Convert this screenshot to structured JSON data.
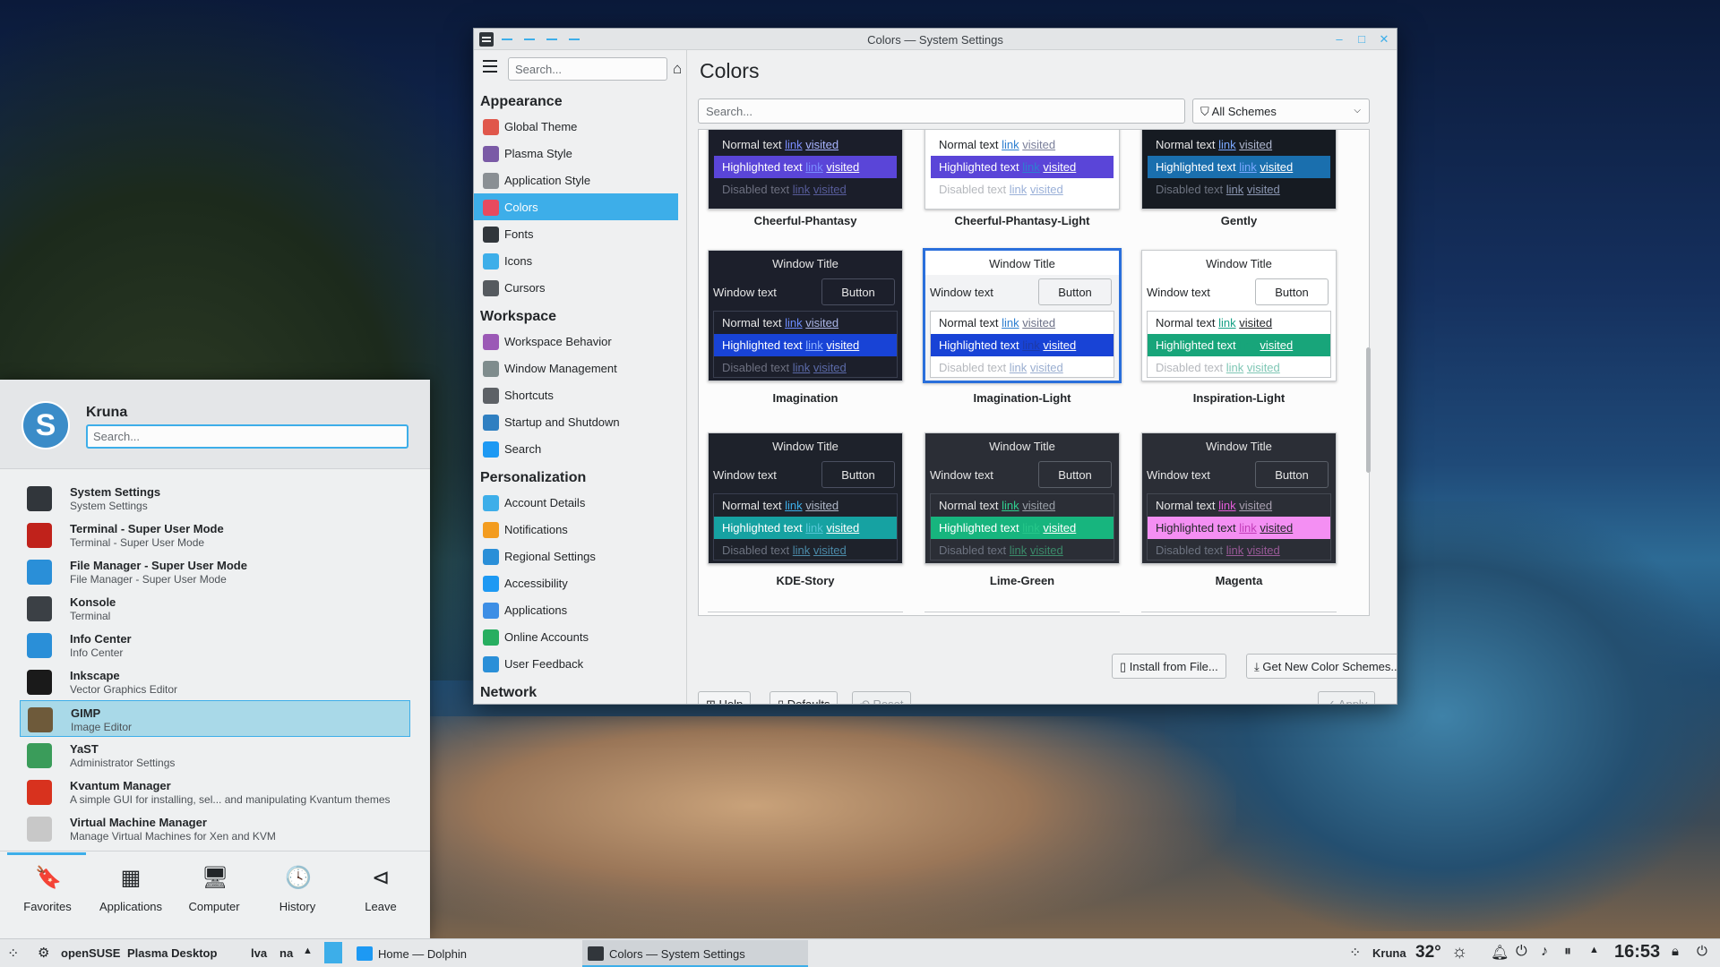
{
  "window": {
    "title": "Colors — System Settings",
    "buttons": {
      "minimize": "–",
      "maximize": "□",
      "close": "✕"
    }
  },
  "sidebar": {
    "search_placeholder": "Search...",
    "sections": [
      {
        "title": "Appearance",
        "items": [
          {
            "label": "Global Theme",
            "icon": "global-theme-icon",
            "color": "#e0574b"
          },
          {
            "label": "Plasma Style",
            "icon": "plasma-style-icon",
            "color": "#7a5aa6"
          },
          {
            "label": "Application Style",
            "icon": "application-style-icon",
            "color": "#8a8f94"
          },
          {
            "label": "Colors",
            "icon": "colors-icon",
            "color": "#e84a5f",
            "active": true
          },
          {
            "label": "Fonts",
            "icon": "fonts-icon",
            "color": "#31363b"
          },
          {
            "label": "Icons",
            "icon": "icons-icon",
            "color": "#3daee9"
          },
          {
            "label": "Cursors",
            "icon": "cursors-icon",
            "color": "#555a5f"
          }
        ]
      },
      {
        "title": "Workspace",
        "items": [
          {
            "label": "Workspace Behavior",
            "icon": "workspace-behavior-icon",
            "color": "#9b59b6"
          },
          {
            "label": "Window Management",
            "icon": "window-management-icon",
            "color": "#7f8c8d"
          },
          {
            "label": "Shortcuts",
            "icon": "shortcuts-icon",
            "color": "#5d6166"
          },
          {
            "label": "Startup and Shutdown",
            "icon": "startup-shutdown-icon",
            "color": "#2f7fc1"
          },
          {
            "label": "Search",
            "icon": "search-icon",
            "color": "#1d99f3"
          }
        ]
      },
      {
        "title": "Personalization",
        "items": [
          {
            "label": "Account Details",
            "icon": "account-details-icon",
            "color": "#3daee9"
          },
          {
            "label": "Notifications",
            "icon": "notifications-icon",
            "color": "#f39c1f"
          },
          {
            "label": "Regional Settings",
            "icon": "regional-settings-icon",
            "color": "#2a8fd8"
          },
          {
            "label": "Accessibility",
            "icon": "accessibility-icon",
            "color": "#1d99f3"
          },
          {
            "label": "Applications",
            "icon": "applications-icon",
            "color": "#3c8ee5"
          },
          {
            "label": "Online Accounts",
            "icon": "online-accounts-icon",
            "color": "#27ae60"
          },
          {
            "label": "User Feedback",
            "icon": "user-feedback-icon",
            "color": "#2a8fd8"
          }
        ]
      },
      {
        "title": "Network",
        "items": []
      }
    ]
  },
  "main": {
    "title": "Colors",
    "search_placeholder": "Search...",
    "filter_label": "All Schemes",
    "preview_labels": {
      "window_title": "Window Title",
      "window_text": "Window text",
      "button": "Button",
      "normal": "Normal text",
      "highlighted": "Highlighted text",
      "disabled": "Disabled text",
      "link": "link",
      "visited": "visited"
    },
    "schemes_top": [
      {
        "name": "Cheerful-Phantasy",
        "view": "#1b1e2a",
        "view_fg": "#e6e6e6",
        "hl": "#5a45d8",
        "hl_fg": "#ffffff",
        "link": "#7a8cff",
        "visited": "#a8b4ff",
        "dis": "#6d7080",
        "dis_link": "#575c9a"
      },
      {
        "name": "Cheerful-Phantasy-Light",
        "view": "#ffffff",
        "view_fg": "#232629",
        "hl": "#5a45d8",
        "hl_fg": "#ffffff",
        "link": "#2e7fd0",
        "visited": "#7a7f9a",
        "dis": "#b5b8bd",
        "dis_link": "#9ab0d8"
      },
      {
        "name": "Gently",
        "view": "#161b22",
        "view_fg": "#e6e6e6",
        "hl": "#1a6fae",
        "hl_fg": "#ffffff",
        "link": "#7aa8ff",
        "visited": "#b0b8d0",
        "dis": "#6d7380",
        "dis_link": "#8a95b0"
      }
    ],
    "schemes": [
      {
        "name": "Imagination",
        "header": "#1c1f2b",
        "header_fg": "#e6e6e6",
        "win": "#1c1f2b",
        "win_fg": "#e6e6e6",
        "btn": "#1c1f2b",
        "btn_border": "#4a4f60",
        "btn_fg": "#e6e6e6",
        "view": "#1c1f2b",
        "view_fg": "#e6e6e6",
        "view_border": "#3a3f50",
        "hl": "#1843d6",
        "hl_fg": "#ffffff",
        "link": "#6c8cff",
        "visited": "#aab5e6",
        "hl_link": "#8fb0ff",
        "dis": "#6d7080",
        "dis_link": "#5b6aa8",
        "selected": false
      },
      {
        "name": "Imagination-Light",
        "header": "#ffffff",
        "header_fg": "#232629",
        "win": "#f2f3f5",
        "win_fg": "#232629",
        "btn": "#f2f3f5",
        "btn_border": "#b7bbbe",
        "btn_fg": "#232629",
        "view": "#ffffff",
        "view_fg": "#232629",
        "view_border": "#c4c7ca",
        "hl": "#1843d6",
        "hl_fg": "#ffffff",
        "link": "#2e7fd0",
        "visited": "#6d7288",
        "hl_link": "#1d3aa8",
        "dis": "#b5b8bd",
        "dis_link": "#9aaed0",
        "selected": true
      },
      {
        "name": "Inspiration-Light",
        "header": "#ffffff",
        "header_fg": "#232629",
        "win": "#ffffff",
        "win_fg": "#232629",
        "btn": "#ffffff",
        "btn_border": "#b7bbbe",
        "btn_fg": "#232629",
        "view": "#ffffff",
        "view_fg": "#232629",
        "view_border": "#c4c7ca",
        "hl": "#18a57a",
        "hl_fg": "#ffffff",
        "link": "#16a085",
        "visited": "#232629",
        "hl_link": "#18a57a",
        "dis": "#b5b8bd",
        "dis_link": "#7fc7b5",
        "selected": false
      },
      {
        "name": "KDE-Story",
        "header": "#1e222b",
        "header_fg": "#e6e6e6",
        "win": "#1e222b",
        "win_fg": "#e6e6e6",
        "btn": "#1e222b",
        "btn_border": "#4a4f60",
        "btn_fg": "#e6e6e6",
        "view": "#1e222b",
        "view_fg": "#e6e6e6",
        "view_border": "#3a3f50",
        "hl": "#16a2a2",
        "hl_fg": "#ffffff",
        "link": "#3daee9",
        "visited": "#b0b8c8",
        "hl_link": "#56c6d6",
        "dis": "#6d7380",
        "dis_link": "#4b8aa8",
        "selected": false
      },
      {
        "name": "Lime-Green",
        "header": "#2b2e36",
        "header_fg": "#e6e6e6",
        "win": "#2b2e36",
        "win_fg": "#e6e6e6",
        "btn": "#2b2e36",
        "btn_border": "#5a5f68",
        "btn_fg": "#e6e6e6",
        "view": "#2b2e36",
        "view_fg": "#e6e6e6",
        "view_border": "#444852",
        "hl": "#17b57e",
        "hl_fg": "#ffffff",
        "link": "#2fcf8f",
        "visited": "#9aa0a8",
        "hl_link": "#27c78a",
        "dis": "#6d7380",
        "dis_link": "#3b8a6a",
        "selected": false
      },
      {
        "name": "Magenta",
        "header": "#2b2e36",
        "header_fg": "#e6e6e6",
        "win": "#2b2e36",
        "win_fg": "#e6e6e6",
        "btn": "#2b2e36",
        "btn_border": "#5a5f68",
        "btn_fg": "#e6e6e6",
        "view": "#2b2e36",
        "view_fg": "#e6e6e6",
        "view_border": "#444852",
        "hl": "#f48ff3",
        "hl_fg": "#232629",
        "link": "#e25cd8",
        "visited": "#a8a0b0",
        "hl_link": "#c23cb8",
        "dis": "#6d7380",
        "dis_link": "#9a5a98",
        "selected": false
      }
    ],
    "buttons": {
      "install": "Install from File...",
      "get_new": "Get New Color Schemes...",
      "help": "Help",
      "defaults": "Defaults",
      "reset": "Reset",
      "apply": "Apply"
    }
  },
  "launcher": {
    "user": "Kruna",
    "search_placeholder": "Search...",
    "items": [
      {
        "title": "System Settings",
        "subtitle": "System Settings",
        "icon": "system-settings-icon",
        "color": "#31363b"
      },
      {
        "title": "Terminal - Super User Mode",
        "subtitle": "Terminal - Super User Mode",
        "icon": "terminal-su-icon",
        "color": "#c0221b"
      },
      {
        "title": "File Manager - Super User Mode",
        "subtitle": "File Manager - Super User Mode",
        "icon": "file-manager-su-icon",
        "color": "#2a8fd8"
      },
      {
        "title": "Konsole",
        "subtitle": "Terminal",
        "icon": "konsole-icon",
        "color": "#3b4045"
      },
      {
        "title": "Info Center",
        "subtitle": "Info Center",
        "icon": "info-center-icon",
        "color": "#2a8fd8"
      },
      {
        "title": "Inkscape",
        "subtitle": "Vector Graphics Editor",
        "icon": "inkscape-icon",
        "color": "#1a1a1a"
      },
      {
        "title": "GIMP",
        "subtitle": "Image Editor",
        "icon": "gimp-icon",
        "color": "#6e5a3a",
        "selected": true
      },
      {
        "title": "YaST",
        "subtitle": "Administrator Settings",
        "icon": "yast-icon",
        "color": "#3a9c5a"
      },
      {
        "title": "Kvantum Manager",
        "subtitle": "A simple GUI for installing, sel... and manipulating Kvantum themes",
        "icon": "kvantum-icon",
        "color": "#d8321e"
      },
      {
        "title": "Virtual Machine Manager",
        "subtitle": "Manage Virtual Machines for Xen and KVM",
        "icon": "vmm-icon",
        "color": "#c8c8c8"
      }
    ],
    "tabs": [
      {
        "label": "Favorites",
        "icon": "bookmark-icon",
        "glyph": "🔖"
      },
      {
        "label": "Applications",
        "icon": "applications-grid-icon",
        "glyph": "▦"
      },
      {
        "label": "Computer",
        "icon": "computer-icon",
        "glyph": "🖥"
      },
      {
        "label": "History",
        "icon": "history-icon",
        "glyph": "🕓"
      },
      {
        "label": "Leave",
        "icon": "leave-icon",
        "glyph": "⊲"
      }
    ]
  },
  "taskbar": {
    "opensuse": "openSUSE",
    "plasma": "Plasma Desktop",
    "w1": "lva",
    "w2": "na",
    "tasks": [
      {
        "label": "Home — Dolphin",
        "icon": "dolphin-icon",
        "color": "#1d99f3"
      },
      {
        "label": "Colors — System Settings",
        "icon": "system-settings-icon",
        "color": "#31363b",
        "active": true
      }
    ],
    "user": "Kruna",
    "temperature": "32°",
    "clock": "16:53"
  }
}
